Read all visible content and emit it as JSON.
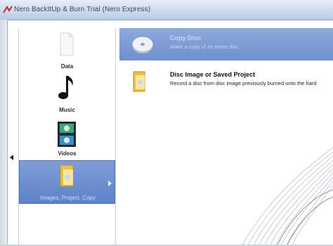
{
  "window": {
    "title": "Nero BackItUp & Burn Trial (Nero Express)"
  },
  "sidebar": {
    "items": [
      {
        "label": "Data",
        "icon": "blank-document-icon",
        "selected": false
      },
      {
        "label": "Music",
        "icon": "music-note-icon",
        "selected": false
      },
      {
        "label": "Videos",
        "icon": "film-reel-icon",
        "selected": false
      },
      {
        "label": "Images, Project, Copy",
        "icon": "folder-icon",
        "selected": true
      }
    ]
  },
  "main": {
    "tasks": [
      {
        "title": "Copy Disc",
        "description": "Make a copy of an entire disc",
        "icon": "disc-copy-icon",
        "highlighted": true
      },
      {
        "title": "Disc Image or Saved Project",
        "description": "Record a disc from disc image previously burned onto the hard",
        "icon": "project-folder-icon",
        "highlighted": false
      }
    ]
  },
  "colors": {
    "selection": "#6f8fcf",
    "titlebar": "#c9d8ec"
  }
}
